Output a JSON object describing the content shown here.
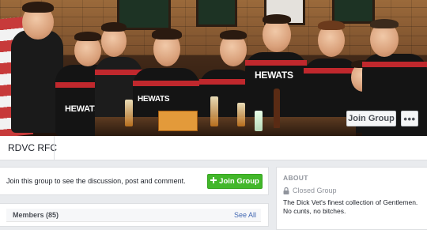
{
  "cover": {
    "jersey_text": "HEWATS",
    "join_label": "Join Group",
    "more_label": "•••"
  },
  "group": {
    "name": "RDVC RFC"
  },
  "join_card": {
    "prompt": "Join this group to see the discussion, post and comment.",
    "button_label": "Join Group",
    "button_icon": "plus-icon",
    "accent": "#42b72a"
  },
  "members": {
    "title": "Members (85)",
    "see_all_label": "See All"
  },
  "about": {
    "title": "ABOUT",
    "privacy_icon": "lock-icon",
    "privacy": "Closed Group",
    "description": "The Dick Vet's finest collection of Gentlemen. No cunts, no bitches."
  },
  "colors": {
    "page_bg": "#e9ebee",
    "link": "#4267b2",
    "jersey_red": "#c0282d"
  }
}
